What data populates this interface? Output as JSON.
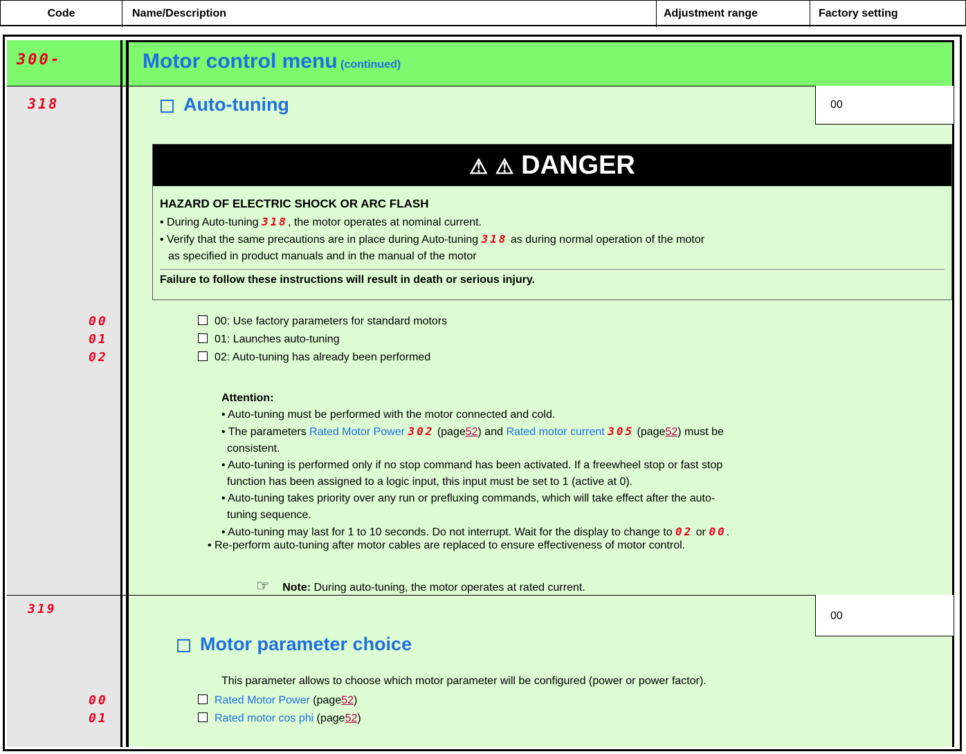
{
  "header": {
    "code": "Code",
    "name": "Name/Description",
    "range": "Adjustment range",
    "factory": "Factory setting"
  },
  "menu": {
    "code": "300-",
    "title": "Motor control menu",
    "suffix": "(continued)"
  },
  "autotune": {
    "code": "318",
    "title": "Auto-tuning",
    "factory": "00",
    "options": [
      {
        "code": "00",
        "text": "00: Use factory parameters for standard motors"
      },
      {
        "code": "01",
        "text": "01: Launches auto-tuning"
      },
      {
        "code": "02",
        "text": "02: Auto-tuning has already been performed"
      }
    ],
    "attention_label": "Attention:",
    "att1": "Auto-tuning must be performed with the motor connected and cold.",
    "att2_a": "The parameters",
    "att2_link1": "Rated Motor Power",
    "att2_code1": "302",
    "att2_p1_open": "(page",
    "att2_page1": "52",
    "att2_p1_close": ") and",
    "att2_link2": "Rated motor current",
    "att2_code2": "305",
    "att2_p2_open": "(page",
    "att2_page2": "52",
    "att2_p2_close": ") must be",
    "att2_b": "consistent.",
    "att3_a": "Auto-tuning is performed only if no stop command has been activated. If a freewheel stop or fast stop",
    "att3_b": "function has been assigned to a logic input, this input must be set to 1 (active at 0).",
    "att4_a": "Auto-tuning takes priority over any run or prefluxing commands, which will take effect after the auto-",
    "att4_b": "tuning sequence.",
    "att5": "Auto-tuning may last for 1 to 10 seconds. Do not interrupt. Wait for the display to change to",
    "att5_code1": "02",
    "att5_or": "or",
    "att5_code2": "00",
    "att5_end": ".",
    "reperform": "Re-perform auto-tuning after motor cables are replaced to ensure effectiveness of motor control.",
    "note_label": "Note:",
    "note_text": "During auto-tuning, the motor operates at rated current."
  },
  "danger": {
    "title": "DANGER",
    "heading": "HAZARD OF ELECTRIC SHOCK OR ARC FLASH",
    "b1_a": "During Auto-tuning",
    "b1_code": "318",
    "b1_b": ", the motor operates at nominal current.",
    "b2_a": "Verify that the same precautions are in place during Auto-tuning",
    "b2_code": "318",
    "b2_b": "as during normal operation of the motor",
    "b2_c": "as specified in product manuals and in the manual of the motor",
    "footer": "Failure to follow these instructions will result in death or serious injury."
  },
  "motorparam": {
    "code": "319",
    "title": "Motor parameter choice",
    "factory": "00",
    "desc": "This parameter allows to choose which motor parameter will be configured (power or power factor).",
    "opt_codes": [
      "00",
      "01"
    ],
    "opt1_link": "Rated Motor Power",
    "opt1_open": "(page",
    "opt1_page": "52",
    "opt1_close": ")",
    "opt2_link": "Rated motor cos phi",
    "opt2_open": "(page",
    "opt2_page": "52",
    "opt2_close": ")"
  }
}
